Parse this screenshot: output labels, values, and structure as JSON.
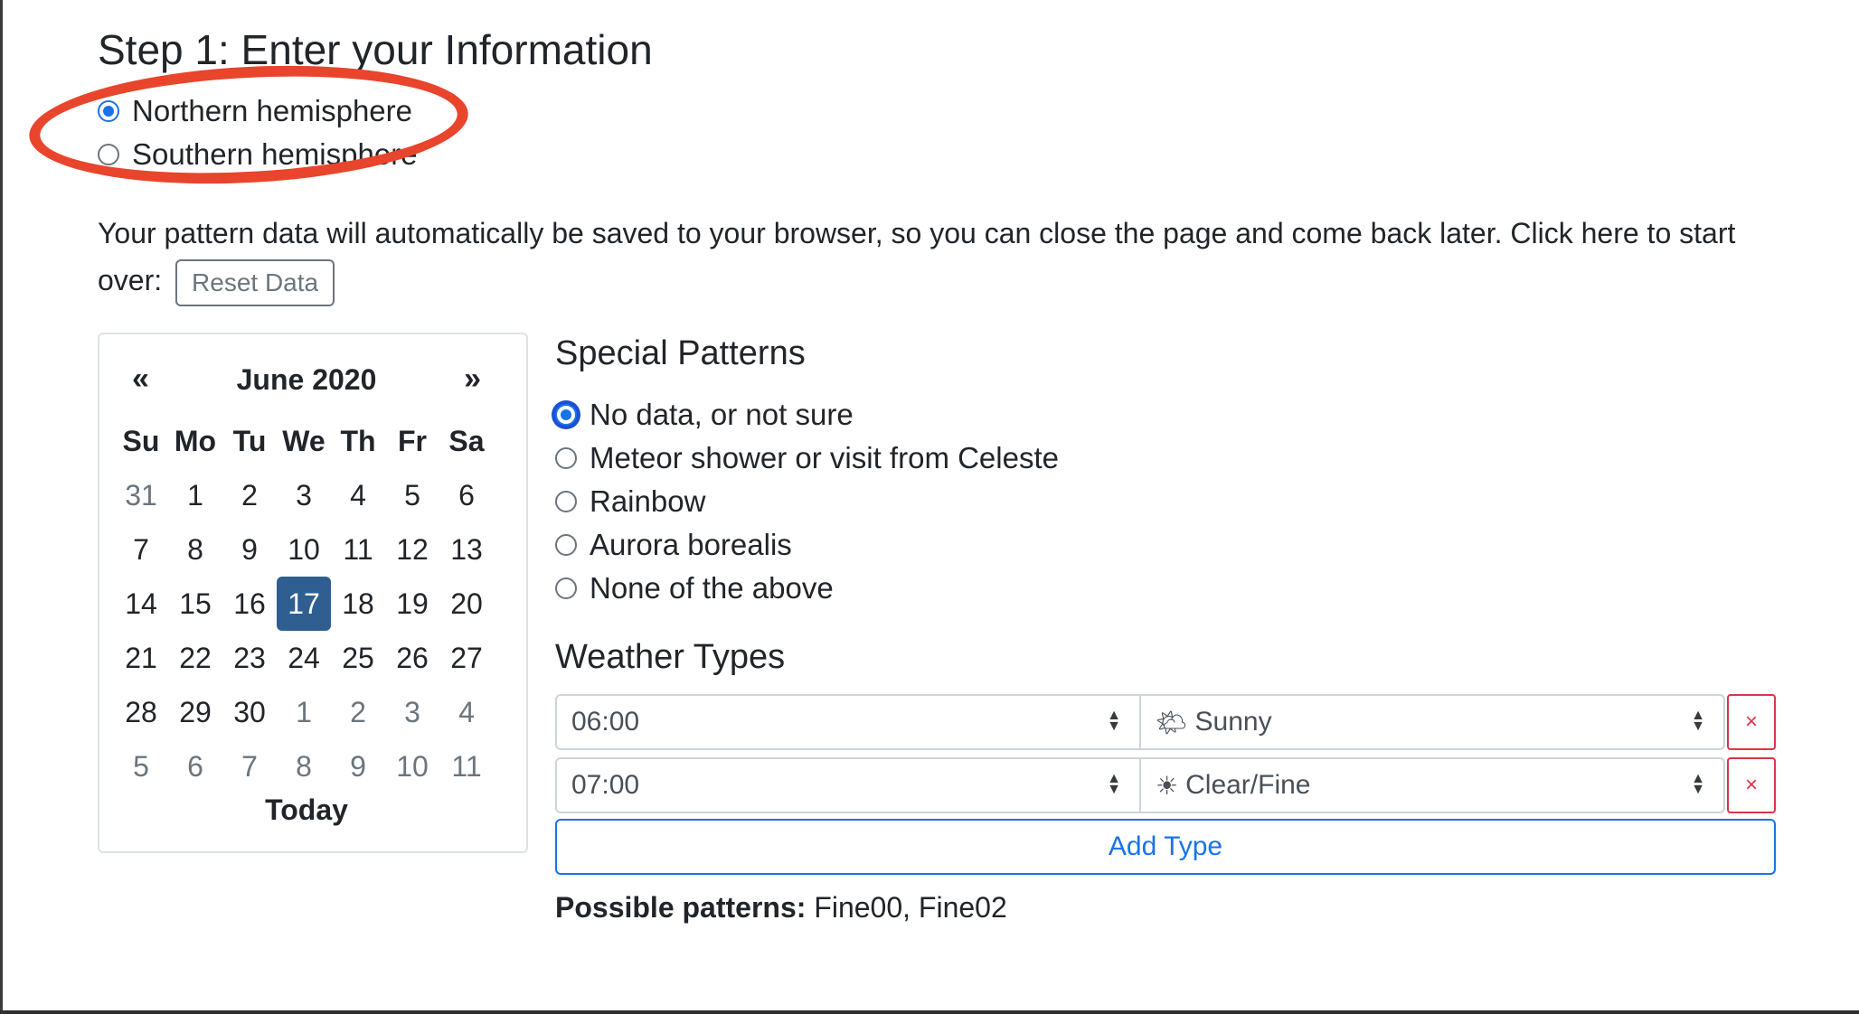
{
  "step_title": "Step 1: Enter your Information",
  "hemisphere": {
    "options": [
      {
        "label": "Northern hemisphere",
        "checked": true
      },
      {
        "label": "Southern hemisphere",
        "checked": false
      }
    ]
  },
  "info": {
    "text_before": "Your pattern data will automatically be saved to your browser, so you can close the page and come back later. Click here to start over:",
    "reset_label": "Reset Data"
  },
  "calendar": {
    "prev": "«",
    "next": "»",
    "month": "June 2020",
    "weekdays": [
      "Su",
      "Mo",
      "Tu",
      "We",
      "Th",
      "Fr",
      "Sa"
    ],
    "weeks": [
      [
        "31",
        "1",
        "2",
        "3",
        "4",
        "5",
        "6"
      ],
      [
        "7",
        "8",
        "9",
        "10",
        "11",
        "12",
        "13"
      ],
      [
        "14",
        "15",
        "16",
        "17",
        "18",
        "19",
        "20"
      ],
      [
        "21",
        "22",
        "23",
        "24",
        "25",
        "26",
        "27"
      ],
      [
        "28",
        "29",
        "30",
        "1",
        "2",
        "3",
        "4"
      ],
      [
        "5",
        "6",
        "7",
        "8",
        "9",
        "10",
        "11"
      ]
    ],
    "selected": "17",
    "today_label": "Today"
  },
  "special_patterns": {
    "title": "Special Patterns",
    "options": [
      {
        "label": "No data, or not sure",
        "checked": true
      },
      {
        "label": "Meteor shower or visit from Celeste",
        "checked": false
      },
      {
        "label": "Rainbow",
        "checked": false
      },
      {
        "label": "Aurora borealis",
        "checked": false
      },
      {
        "label": "None of the above",
        "checked": false
      }
    ]
  },
  "weather": {
    "title": "Weather Types",
    "rows": [
      {
        "time": "06:00",
        "icon": "🌤",
        "type": "Sunny"
      },
      {
        "time": "07:00",
        "icon": "☀",
        "type": "Clear/Fine"
      }
    ],
    "delete_label": "×",
    "add_label": "Add Type"
  },
  "possible": {
    "label": "Possible patterns:",
    "value": "Fine00, Fine02"
  },
  "colors": {
    "primary": "#1a73e8",
    "danger": "#dc3545",
    "calendar_selected": "#2f5e91",
    "annotation": "#e8452c"
  }
}
